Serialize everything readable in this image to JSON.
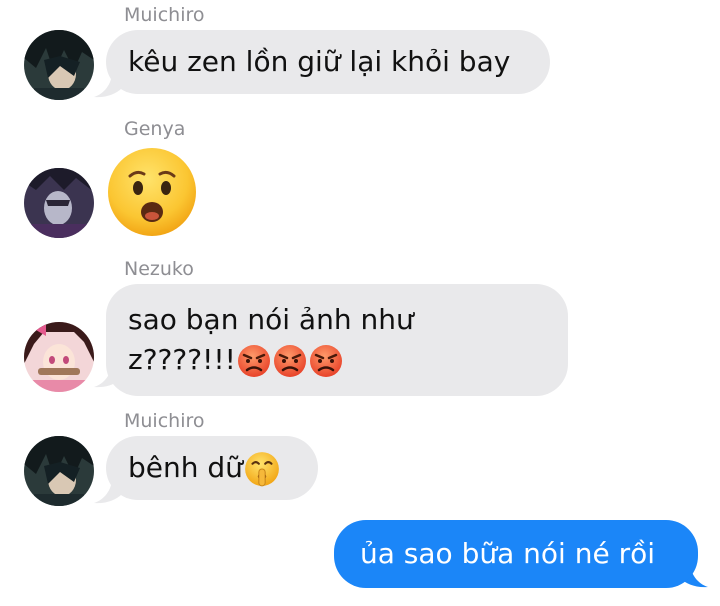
{
  "messages": [
    {
      "sender": "Muichiro",
      "text": "kêu zen lồn giữ lại khỏi bay",
      "direction": "incoming"
    },
    {
      "sender": "Genya",
      "emoji": "face-with-open-mouth-emoji",
      "direction": "incoming"
    },
    {
      "sender": "Nezuko",
      "line1": "sao bạn nói ảnh như",
      "line2": "z????!!!",
      "trailing_emojis": [
        "angry-face-emoji",
        "angry-face-emoji",
        "angry-face-emoji"
      ],
      "direction": "incoming"
    },
    {
      "sender": "Muichiro",
      "text": "bênh dữ",
      "trailing_emoji": "shushing-face-emoji",
      "direction": "incoming"
    },
    {
      "text": "ủa sao bữa nói né rồi",
      "direction": "outgoing"
    }
  ],
  "colors": {
    "incoming_bubble": "#e9e9eb",
    "outgoing_bubble": "#1b86f8",
    "sender_name": "#8e8e93"
  }
}
